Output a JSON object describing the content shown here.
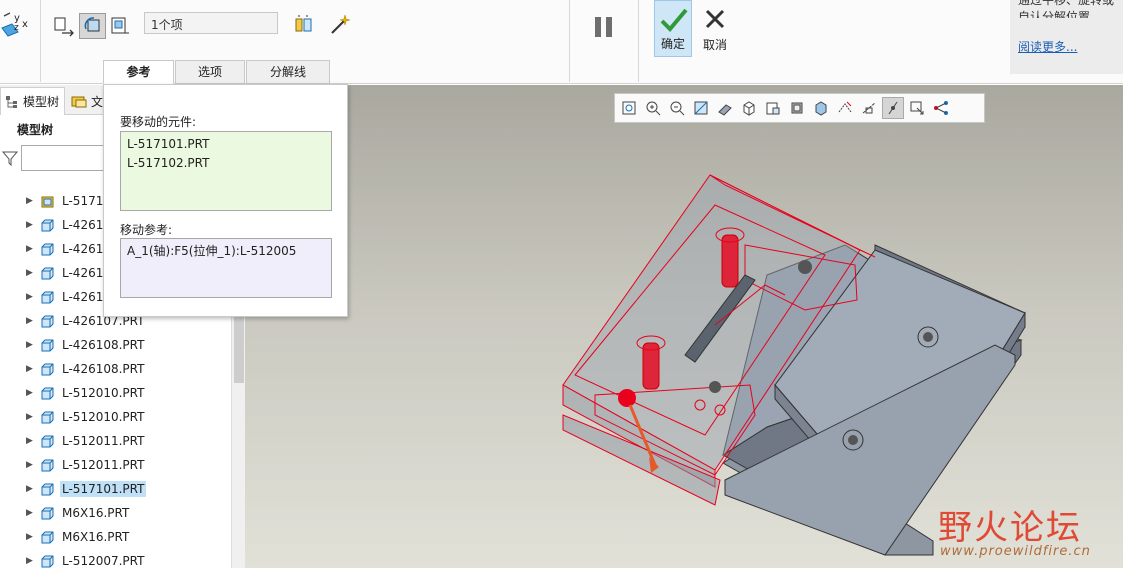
{
  "ribbon": {
    "component_count": "1个项",
    "ok_label": "确定",
    "cancel_label": "取消",
    "help_text_partial": "通过平移、旋转或自认分解位置。",
    "help_link": "阅读更多..."
  },
  "tabs": [
    {
      "label": "参考"
    },
    {
      "label": "选项"
    },
    {
      "label": "分解线"
    }
  ],
  "model_tree": {
    "tab_label": "模型树",
    "tab2_label_partial": "文",
    "title": "模型树",
    "items": [
      {
        "label": "L-5171",
        "selected": false
      },
      {
        "label": "L-42610",
        "selected": false
      },
      {
        "label": "L-42610",
        "selected": false
      },
      {
        "label": "L-42610",
        "selected": false
      },
      {
        "label": "L-42610",
        "selected": false
      },
      {
        "label": "L-426107.PRT",
        "selected": false
      },
      {
        "label": "L-426108.PRT",
        "selected": false
      },
      {
        "label": "L-426108.PRT",
        "selected": false
      },
      {
        "label": "L-512010.PRT",
        "selected": false
      },
      {
        "label": "L-512010.PRT",
        "selected": false
      },
      {
        "label": "L-512011.PRT",
        "selected": false
      },
      {
        "label": "L-512011.PRT",
        "selected": false
      },
      {
        "label": "L-517101.PRT",
        "selected": true
      },
      {
        "label": "M6X16.PRT",
        "selected": false
      },
      {
        "label": "M6X16.PRT",
        "selected": false
      },
      {
        "label": "L-512007.PRT",
        "selected": false
      }
    ]
  },
  "references": {
    "components_label": "要移动的元件:",
    "components": [
      "L-517101.PRT",
      "L-517102.PRT"
    ],
    "move_ref_label": "移动参考:",
    "move_ref": "A_1(轴):F5(拉伸_1):L-512005"
  },
  "watermark": {
    "name": "野火论坛",
    "url": "www.proewildfire.cn"
  },
  "colors": {
    "accent_blue": "#1a5fb4",
    "selection_bg": "#bfe0f6",
    "components_box_bg": "#eaf9df",
    "ref_box_bg": "#f1eefb",
    "highlight_red": "#e8001c",
    "part_gray": "#9aa4b2"
  }
}
